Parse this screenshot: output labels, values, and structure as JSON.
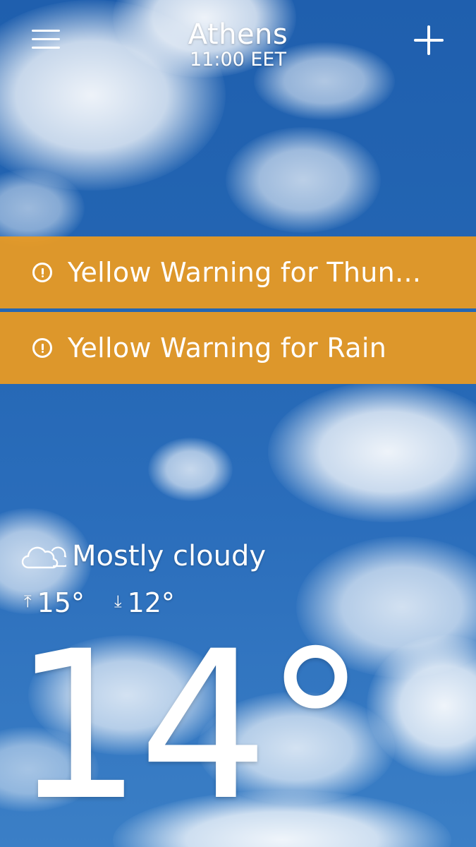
{
  "header": {
    "city": "Athens",
    "time": "11:00 EET",
    "menu_icon": "hamburger-menu-icon",
    "add_icon": "plus-icon"
  },
  "warnings": [
    {
      "label": "Yellow Warning for Thun...",
      "icon": "exclamation-circle-icon"
    },
    {
      "label": "Yellow Warning for Rain",
      "icon": "exclamation-circle-icon"
    }
  ],
  "current": {
    "condition": "Mostly cloudy",
    "condition_icon": "cloud-icon",
    "high": "15°",
    "low": "12°",
    "high_icon": "arrow-up-icon",
    "low_icon": "arrow-down-icon",
    "temperature": "14°"
  },
  "colors": {
    "warning_bg": "#EC9B20",
    "sky": "#2466B3",
    "text": "#FFFFFF"
  }
}
